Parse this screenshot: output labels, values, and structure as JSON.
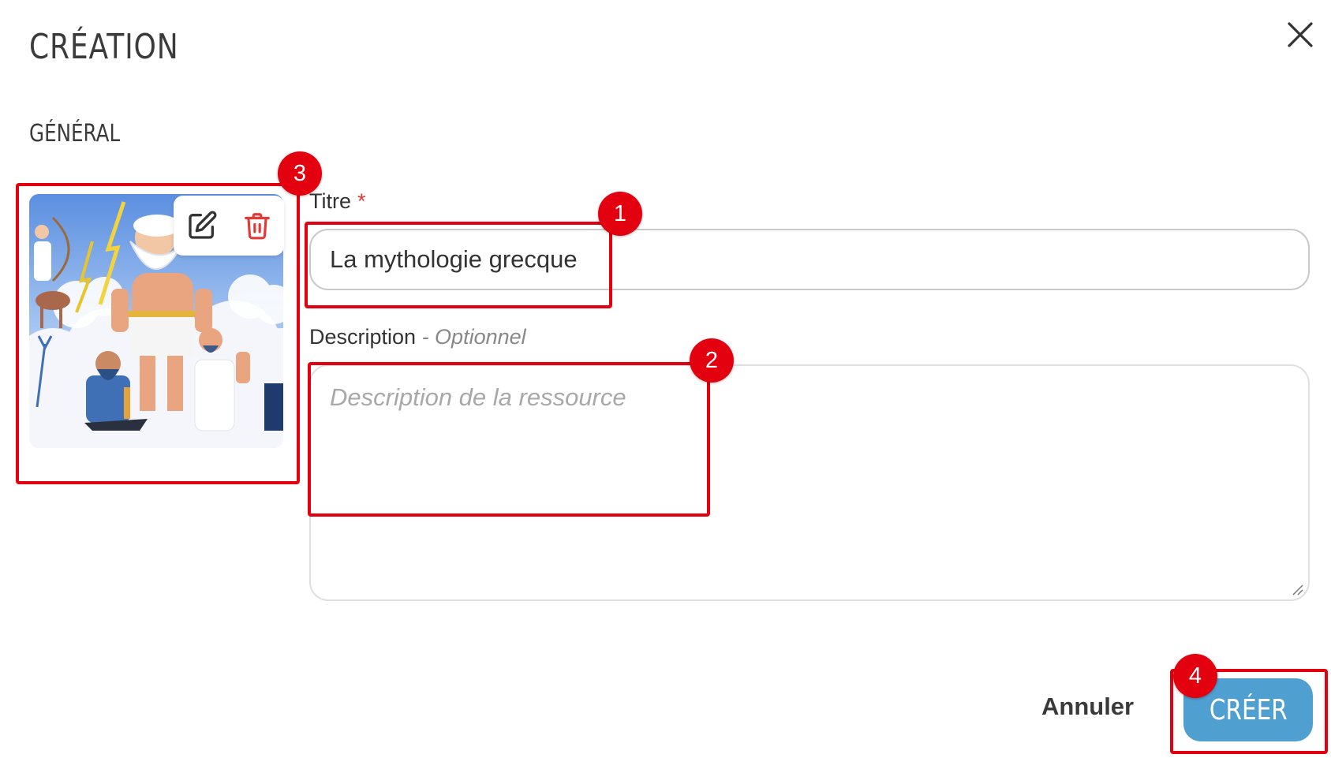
{
  "dialog": {
    "title": "CRÉATION",
    "section_label": "GÉNÉRAL"
  },
  "form": {
    "title_label": "Titre",
    "required_mark": "*",
    "title_value": "La mythologie grecque",
    "description_label": "Description",
    "optional_label": " - Optionnel",
    "description_placeholder": "Description de la ressource"
  },
  "image": {
    "edit_icon": "edit-icon",
    "delete_icon": "trash-icon"
  },
  "actions": {
    "cancel_label": "Annuler",
    "create_label": "CRÉER"
  },
  "annotations": [
    "1",
    "2",
    "3",
    "4"
  ],
  "colors": {
    "primary_button": "#4f9fd0",
    "annotation": "#e3000f",
    "required": "#e53935"
  }
}
